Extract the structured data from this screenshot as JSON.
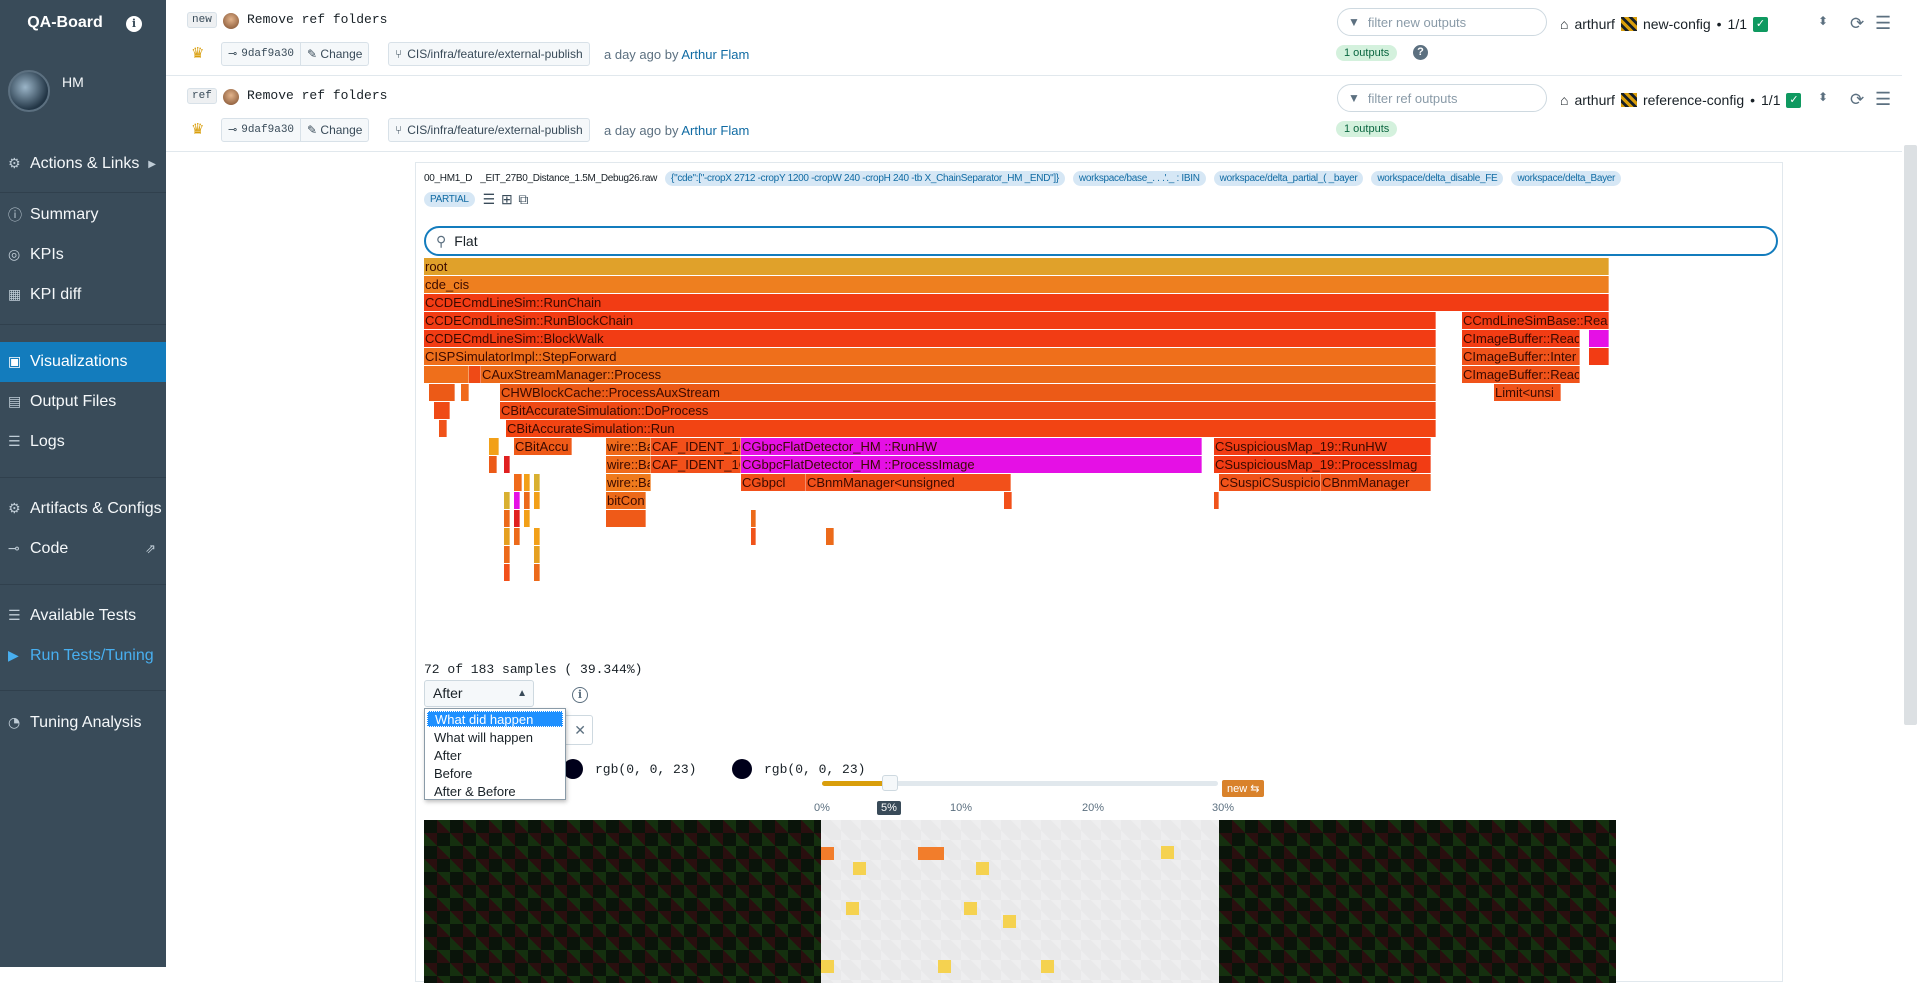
{
  "sidebar": {
    "title": "QA-Board",
    "user": "HM",
    "items": [
      {
        "label": "Actions & Links",
        "icon": "cog-icon"
      },
      {
        "label": "Summary",
        "icon": "info-icon"
      },
      {
        "label": "KPIs",
        "icon": "target-icon"
      },
      {
        "label": "KPI diff",
        "icon": "grid-icon"
      },
      {
        "label": "Visualizations",
        "icon": "image-icon"
      },
      {
        "label": "Output Files",
        "icon": "document-icon"
      },
      {
        "label": "Logs",
        "icon": "list-icon"
      },
      {
        "label": "Artifacts & Configs",
        "icon": "cog-icon"
      },
      {
        "label": "Code",
        "icon": "commit-icon"
      },
      {
        "label": "Available Tests",
        "icon": "list-icon"
      },
      {
        "label": "Run Tests/Tuning",
        "icon": "play-icon"
      },
      {
        "label": "Tuning Analysis",
        "icon": "chart-icon"
      }
    ]
  },
  "batches": [
    {
      "tag": "new",
      "message": "Remove ref folders",
      "hash": "9daf9a30",
      "change": "Change",
      "branch": "CIS/infra/feature/external-publish",
      "ago": "a day ago",
      "by": "by",
      "author": "Arthur Flam",
      "filter_placeholder": "filter new outputs",
      "outputs": "1 outputs",
      "user": "arthurf",
      "config": "new-config",
      "count": "1/1"
    },
    {
      "tag": "ref",
      "message": "Remove ref folders",
      "hash": "9daf9a30",
      "change": "Change",
      "branch": "CIS/infra/feature/external-publish",
      "ago": "a day ago",
      "by": "by",
      "author": "Arthur Flam",
      "filter_placeholder": "filter ref outputs",
      "outputs": "1 outputs",
      "user": "arthurf",
      "config": "reference-config",
      "count": "1/1"
    }
  ],
  "output": {
    "chips": [
      "00_HM1_D",
      "_EIT_27B0_Distance_1.5M_Debug26.raw",
      "{\"cde\":[\"-cropX 2712 -cropY 1200 -cropW 240 -cropH 240 -tb X_ChainSeparator_HM _END\"]}",
      "workspace/base_. . .'._ : IBIN",
      "workspace/delta_partial_(  _bayer",
      "workspace/delta_disable_FE",
      "workspace/delta_Bayer",
      "PARTIAL"
    ],
    "search_value": "Flat",
    "flame_frames": [
      {
        "label": "root"
      },
      {
        "label": "cde_cis"
      },
      {
        "label": "CCDECmdLineSim::RunChain"
      },
      {
        "label": "CCDECmdLineSim::RunBlockChain"
      },
      {
        "label": "CCDECmdLineSim::BlockWalk"
      },
      {
        "label": "CISPSimulatorImpl::StepForward"
      },
      {
        "label": "CAuxStreamManager::Process"
      },
      {
        "label": "CHWBlockCache::ProcessAuxStream"
      },
      {
        "label": "CBitAccurateSimulation::DoProcess"
      },
      {
        "label": "CBitAccurateSimulation::Run"
      },
      {
        "label": "CBitAccu"
      },
      {
        "label": "wire::Ba"
      },
      {
        "label": "CAF_IDENT_1C"
      },
      {
        "label": "CGbpcFlatDetector_HM  ::RunHW"
      },
      {
        "label": "wire::Ba"
      },
      {
        "label": "CAF_IDENT_1C"
      },
      {
        "label": "CGbpcFlatDetector_HM  ::ProcessImage"
      },
      {
        "label": "wire::Ba"
      },
      {
        "label": "CGbpcl"
      },
      {
        "label": "CBnmManager<unsigned"
      },
      {
        "label": "bitConv"
      },
      {
        "label": "CSuspiciousMap_19::RunHW"
      },
      {
        "label": "CSuspiciousMap_19::ProcessImag"
      },
      {
        "label": "CSuspic"
      },
      {
        "label": "CSuspicio"
      },
      {
        "label": "CBnmManager"
      },
      {
        "label": "CCmdLineSimBase::Rea"
      },
      {
        "label": "CImageBuffer::Reac"
      },
      {
        "label": "CImageBuffer::Inter"
      },
      {
        "label": "CImageBuffer::Reac"
      },
      {
        "label": "Limit<unsi"
      }
    ],
    "samples": "72 of 183 samples ( 39.344%)",
    "mode_selected": "After",
    "mode_options": [
      "What did happen",
      "What will happen",
      "After",
      "Before",
      "After & Before"
    ],
    "color_a": "rgb(0, 0, 23)",
    "color_b": "rgb(0, 0, 23)",
    "slider": {
      "labels": [
        "0%",
        "10%",
        "20%",
        "30%"
      ],
      "value": "5%",
      "value_fraction": 0.05
    },
    "new_badge": "new"
  },
  "colors": {
    "accent": "#137cbd",
    "sidebar": "#394b59",
    "highlight": "#e510e5"
  }
}
